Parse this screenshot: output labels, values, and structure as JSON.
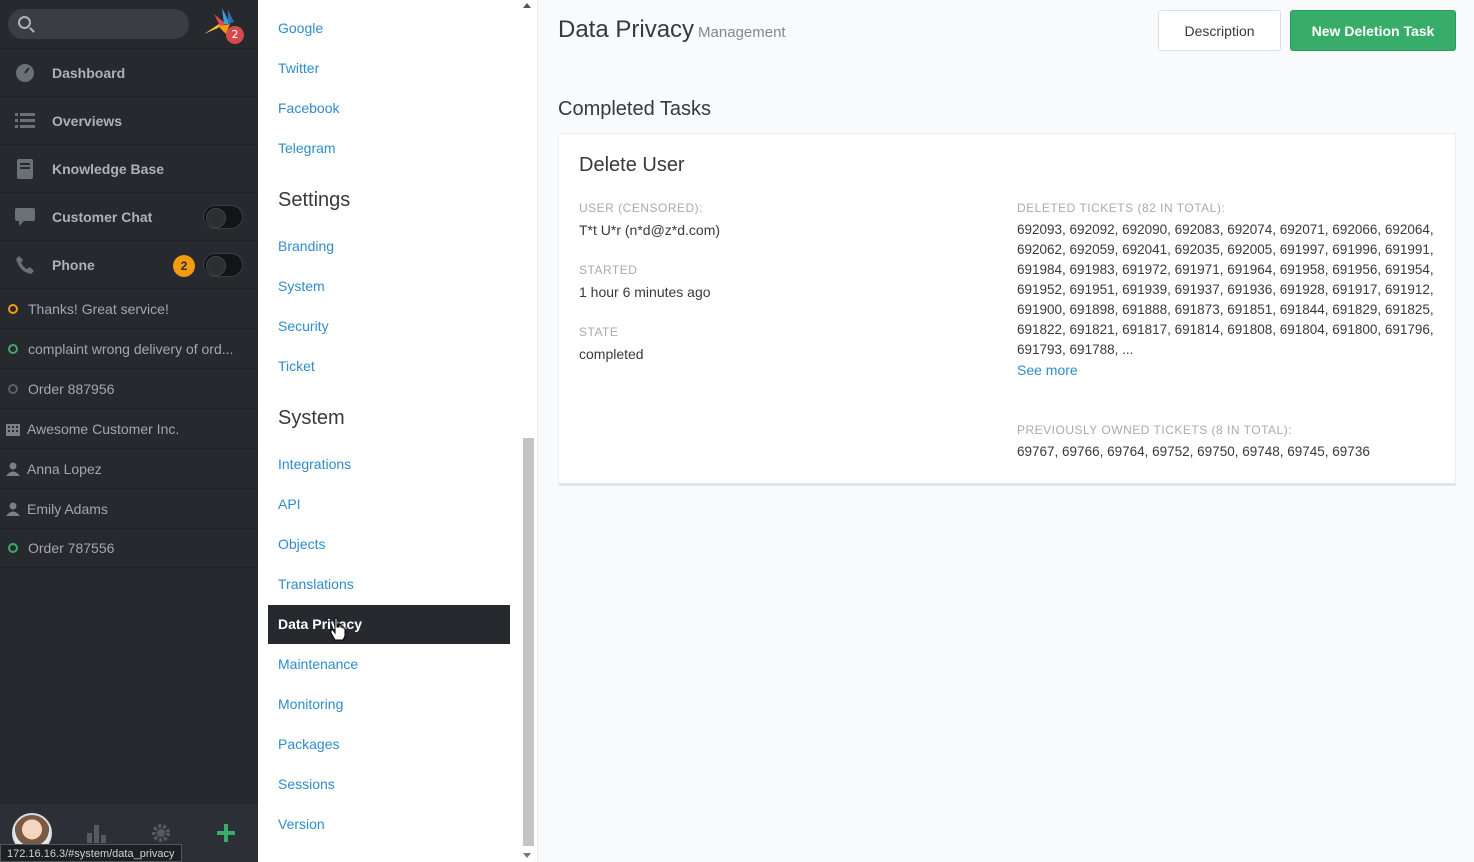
{
  "nav": {
    "menu": [
      {
        "label": "Dashboard",
        "icon": "dashboard-icon"
      },
      {
        "label": "Overviews",
        "icon": "list-icon"
      },
      {
        "label": "Knowledge Base",
        "icon": "book-icon"
      },
      {
        "label": "Customer Chat",
        "icon": "chat-icon"
      },
      {
        "label": "Phone",
        "icon": "phone-icon",
        "badge": "2"
      }
    ],
    "logo_badge": "2",
    "tasks": [
      {
        "label": "Thanks! Great service!",
        "type": "ticket",
        "status": "orange"
      },
      {
        "label": "complaint wrong delivery of ord...",
        "type": "ticket",
        "status": "green"
      },
      {
        "label": "Order 887956",
        "type": "ticket",
        "status": "gray"
      },
      {
        "label": "Awesome Customer Inc.",
        "type": "organization"
      },
      {
        "label": "Anna Lopez",
        "type": "user"
      },
      {
        "label": "Emily Adams",
        "type": "user"
      },
      {
        "label": "Order 787556",
        "type": "ticket",
        "status": "green"
      }
    ],
    "url_tooltip": "172.16.16.3/#system/data_privacy"
  },
  "settings_nav": {
    "channels": [
      "Google",
      "Twitter",
      "Facebook",
      "Telegram"
    ],
    "settings_heading": "Settings",
    "settings": [
      "Branding",
      "System",
      "Security",
      "Ticket"
    ],
    "system_heading": "System",
    "system": [
      "Integrations",
      "API",
      "Objects",
      "Translations",
      "Data Privacy",
      "Maintenance",
      "Monitoring",
      "Packages",
      "Sessions",
      "Version"
    ],
    "active": "Data Privacy"
  },
  "main": {
    "title": "Data Privacy",
    "subtitle": "Management",
    "description_button": "Description",
    "new_button": "New Deletion Task",
    "section_title": "Completed Tasks",
    "task": {
      "title": "Delete User",
      "user_label": "User (censored):",
      "user_value": "T*t U*r (n*d@z*d.com)",
      "started_label": "Started",
      "started_value": "1 hour 6 minutes ago",
      "state_label": "State",
      "state_value": "completed",
      "deleted_label": "Deleted Tickets (82 in total):",
      "deleted_value": "692093, 692092, 692090, 692083, 692074, 692071, 692066, 692064, 692062, 692059, 692041, 692035, 692005, 691997, 691996, 691991, 691984, 691983, 691972, 691971, 691964, 691958, 691956, 691954, 691952, 691951, 691939, 691937, 691936, 691928, 691917, 691912, 691900, 691898, 691888, 691873, 691851, 691844, 691829, 691825, 691822, 691821, 691817, 691814, 691808, 691804, 691800, 691796, 691793, 691788, ...",
      "see_more": "See more",
      "owned_label": "Previously owned tickets (8 in total):",
      "owned_value": "69767, 69766, 69764, 69752, 69750, 69748, 69745, 69736"
    }
  },
  "colors": {
    "accent_green": "#38ad69",
    "link_blue": "#2f8ccc",
    "nav_dark": "#26292e",
    "status_orange": "#f39c12"
  }
}
